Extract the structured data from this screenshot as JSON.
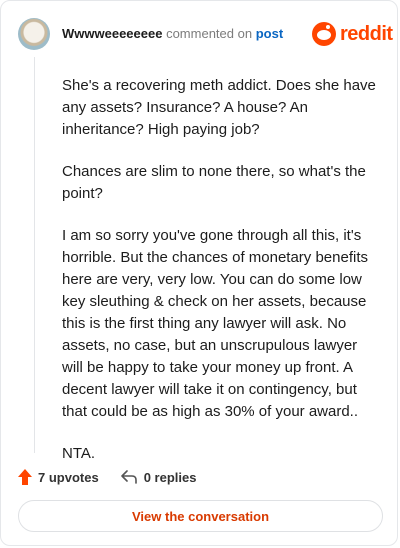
{
  "header": {
    "username": "Wwwweeeeeeee",
    "commented_text": "commented on",
    "post_link": "post"
  },
  "brand": {
    "logo_text": "reddit",
    "accent_color": "#ff4500"
  },
  "comment": {
    "paragraphs": [
      "She's a recovering meth addict. Does she have any assets? Insurance? A house? An inheritance? High paying job?",
      "Chances are slim to none there, so what's the point?",
      "I am so sorry you've gone through all this, it's horrible. But the chances of monetary benefits here are very, very low. You can do some low key sleuthing & check on her assets, because this is the first thing any lawyer will ask. No assets, no case, but an unscrupulous lawyer will be happy to take your money up front. A decent lawyer will take it on contingency, but that could be as high as 30% of your award..",
      "NTA."
    ]
  },
  "actions": {
    "upvotes": "7 upvotes",
    "replies": "0 replies"
  },
  "footer": {
    "view_button": "View the conversation"
  },
  "icons": [
    "avatar",
    "reddit-logo-icon",
    "upvote-arrow-icon",
    "reply-arrow-icon"
  ]
}
